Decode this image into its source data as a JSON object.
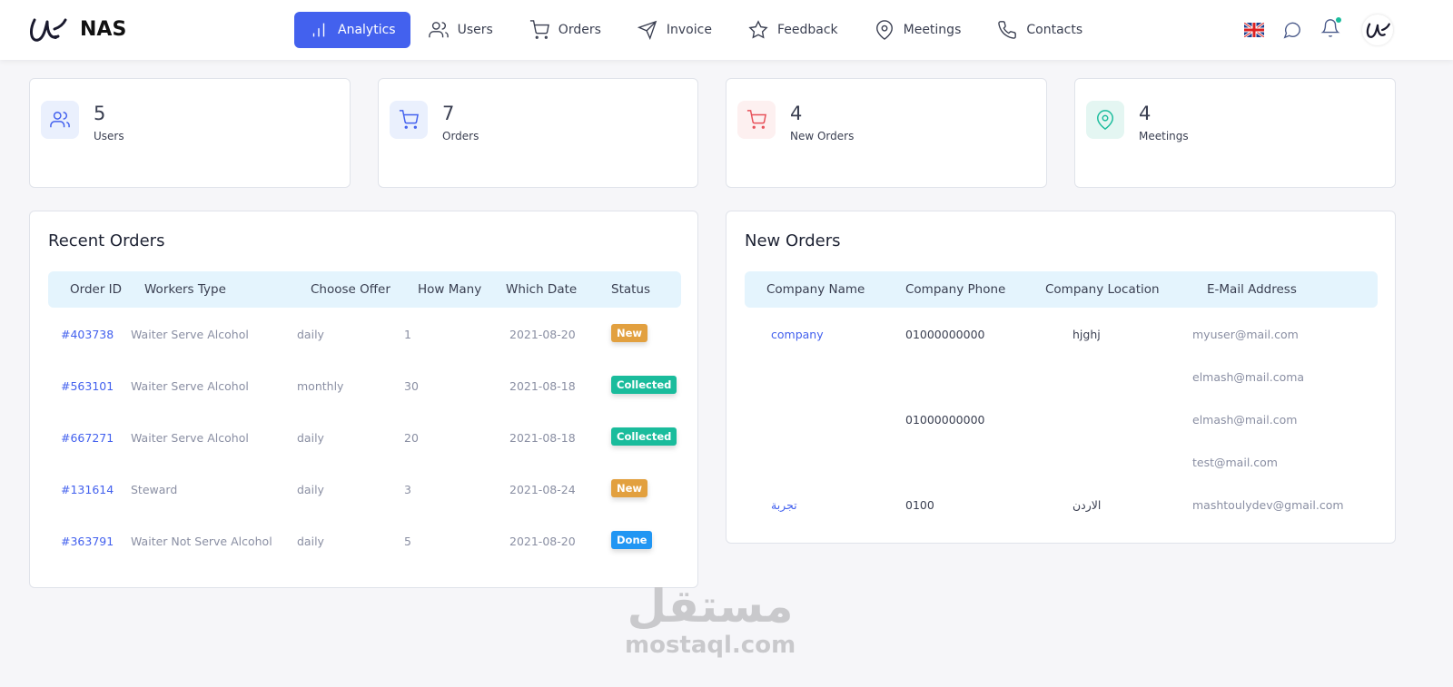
{
  "brand": {
    "name": "NAS"
  },
  "nav": [
    {
      "label": "Analytics",
      "icon": "bar-chart-icon",
      "active": true
    },
    {
      "label": "Users",
      "icon": "users-icon"
    },
    {
      "label": "Orders",
      "icon": "cart-icon"
    },
    {
      "label": "Invoice",
      "icon": "send-icon"
    },
    {
      "label": "Feedback",
      "icon": "star-icon"
    },
    {
      "label": "Meetings",
      "icon": "map-pin-icon"
    },
    {
      "label": "Contacts",
      "icon": "phone-icon"
    }
  ],
  "stats": [
    {
      "value": "5",
      "label": "Users",
      "color": "#4361ee"
    },
    {
      "value": "7",
      "label": "Orders",
      "color": "#4361ee"
    },
    {
      "value": "4",
      "label": "New Orders",
      "color": "#e7515a"
    },
    {
      "value": "4",
      "label": "Meetings",
      "color": "#1abc9c"
    }
  ],
  "recent_orders": {
    "title": "Recent Orders",
    "columns": [
      "Order ID",
      "Workers Type",
      "Choose Offer",
      "How Many",
      "Which Date",
      "Status"
    ],
    "rows": [
      [
        "#403738",
        "Waiter Serve Alcohol",
        "daily",
        "1",
        "2021-08-20",
        "New"
      ],
      [
        "#563101",
        "Waiter Serve Alcohol",
        "monthly",
        "30",
        "2021-08-18",
        "Collected"
      ],
      [
        "#667271",
        "Waiter Serve Alcohol",
        "daily",
        "20",
        "2021-08-18",
        "Collected"
      ],
      [
        "#131614",
        "Steward",
        "daily",
        "3",
        "2021-08-24",
        "New"
      ],
      [
        "#363791",
        "Waiter Not Serve Alcohol",
        "daily",
        "5",
        "2021-08-20",
        "Done"
      ]
    ]
  },
  "status_colors": {
    "New": "#e2a03f",
    "Collected": "#1abc9c",
    "Done": "#2196f3"
  },
  "new_orders": {
    "title": "New Orders",
    "columns": [
      "Company Name",
      "Company Phone",
      "Company Location",
      "E-Mail Address"
    ],
    "rows": [
      [
        "company",
        "01000000000",
        "hjghj",
        "myuser@mail.com"
      ],
      [
        "",
        "",
        "",
        "elmash@mail.coma"
      ],
      [
        "",
        "01000000000",
        "",
        "elmash@mail.com"
      ],
      [
        "",
        "",
        "",
        "test@mail.com"
      ],
      [
        "تجربة",
        "0100",
        "الاردن",
        "mashtoulydev@gmail.com"
      ]
    ]
  },
  "watermark": {
    "arabic": "مستقل",
    "latin": "mostaql.com"
  }
}
